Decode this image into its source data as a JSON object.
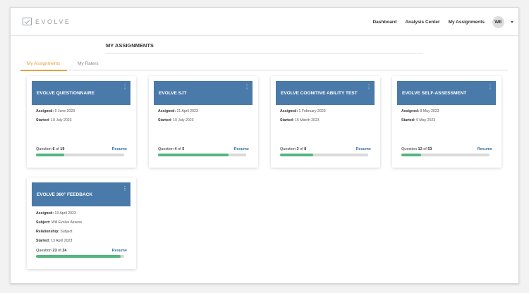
{
  "brand": {
    "name": "EVOLVE"
  },
  "nav": {
    "dashboard": "Dashboard",
    "analysis": "Analysis Center",
    "assignments": "My Assignments"
  },
  "user": {
    "initials": "WE"
  },
  "page": {
    "title": "MY ASSIGNMENTS"
  },
  "tabs": [
    {
      "label": "My Assignments",
      "active": true
    },
    {
      "label": "My Raters",
      "active": false
    }
  ],
  "colors": {
    "header": "#4a7aa9",
    "accent": "#e3a03c",
    "progress": "#52b67e"
  },
  "labels": {
    "assigned": "Assigned:",
    "started": "Started:",
    "subject": "Subject:",
    "relationship": "Relationship:",
    "question": "Question",
    "of": "of",
    "resume": "Resume"
  },
  "cards": [
    {
      "title": "EVOLVE QUESTIONNAIRE",
      "assigned": "9 June 2023",
      "started": "10 July 2023",
      "current": "6",
      "total": "19",
      "progress": 0.316
    },
    {
      "title": "EVOLVE SJT",
      "assigned": "21 April 2023",
      "started": "10 July 2023",
      "current": "4",
      "total": "5",
      "progress": 0.8
    },
    {
      "title": "EVOLVE COGNITIVE ABILITY TEST",
      "assigned": "1 February 2023",
      "started": "15 March 2023",
      "current": "3",
      "total": "8",
      "progress": 0.375
    },
    {
      "title": "EVOLVE SELF-ASSESSMENT",
      "assigned": "8 May 2023",
      "started": "9 May 2023",
      "current": "12",
      "total": "53",
      "progress": 0.226
    },
    {
      "title": "EVOLVE 360° FEEDBACK",
      "assigned": "13 April 2023",
      "subject": "Will Evolve Assess",
      "relationship": "Subject",
      "started": "13 April 2023",
      "current": "23",
      "total": "24",
      "progress": 0.958
    }
  ]
}
